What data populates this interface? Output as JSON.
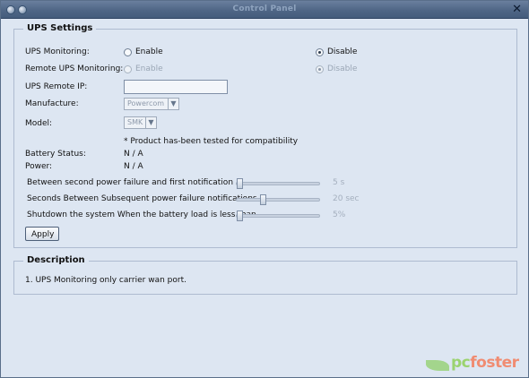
{
  "window": {
    "title": "Control Panel",
    "close_glyph": "✕"
  },
  "ups_settings": {
    "legend": "UPS Settings",
    "ups_monitoring": {
      "label": "UPS Monitoring:",
      "enable": "Enable",
      "disable": "Disable",
      "selected": "disable"
    },
    "remote_ups_monitoring": {
      "label": "Remote UPS Monitoring:",
      "enable": "Enable",
      "disable": "Disable",
      "selected": "disable",
      "disabled": true
    },
    "ups_remote_ip": {
      "label": "UPS Remote IP:",
      "value": ""
    },
    "manufacture": {
      "label": "Manufacture:",
      "value": "Powercom"
    },
    "model": {
      "label": "Model:",
      "value": "SMK"
    },
    "compat_note": "* Product has-been tested for compatibility",
    "battery_status": {
      "label": "Battery Status:",
      "value": "N / A"
    },
    "power": {
      "label": "Power:",
      "value": "N / A"
    },
    "sliders": [
      {
        "label": "Between second power failure and first notification",
        "value": "5 s",
        "position": 0.0
      },
      {
        "label": "Seconds Between Subsequent power failure notifications",
        "value": "20 sec",
        "position": 0.3
      },
      {
        "label": "Shutdown the system When the battery load is less than",
        "value": "5%",
        "position": 0.0
      }
    ],
    "apply_label": "Apply"
  },
  "description": {
    "legend": "Description",
    "text": "1. UPS Monitoring only carrier wan port."
  },
  "watermark": {
    "part1": "pc",
    "part2": "foster"
  },
  "colors": {
    "titlebar": "#4f6686",
    "panel": "#dde6f2",
    "border": "#aebbd0"
  }
}
